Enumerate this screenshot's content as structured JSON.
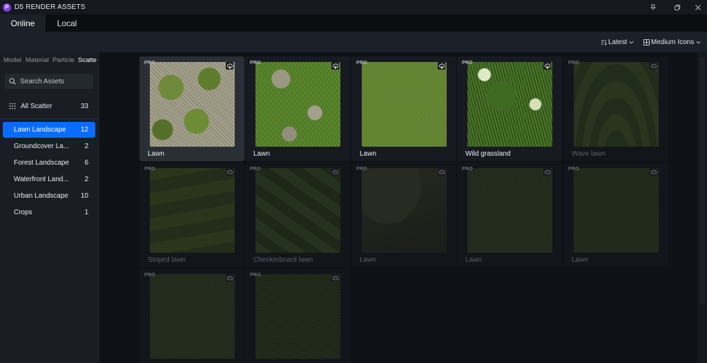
{
  "window": {
    "title": "D5 RENDER ASSETS",
    "logo_letter": "P"
  },
  "tabs": [
    {
      "label": "Online",
      "active": true
    },
    {
      "label": "Local",
      "active": false
    }
  ],
  "toolbar": {
    "sort_label": "Latest",
    "view_label": "Medium Icons"
  },
  "sidebar": {
    "categories": [
      "Model",
      "Material",
      "Particle",
      "Scatte"
    ],
    "active_category": "Scatte",
    "search_placeholder": "Search Assets",
    "all": {
      "label": "All Scatter",
      "count": "33"
    },
    "items": [
      {
        "label": "Lawn Landscape",
        "count": "12",
        "active": true
      },
      {
        "label": "Groundcover La...",
        "count": "2",
        "active": false
      },
      {
        "label": "Forest Landscape",
        "count": "6",
        "active": false
      },
      {
        "label": "Waterfront Land...",
        "count": "2",
        "active": false
      },
      {
        "label": "Urban Landscape",
        "count": "10",
        "active": false
      },
      {
        "label": "Crops",
        "count": "1",
        "active": false
      }
    ]
  },
  "assets": [
    {
      "name": "Lawn",
      "badge": "PRO",
      "style": "patchy",
      "dim": false,
      "highlight": true
    },
    {
      "name": "Lawn",
      "badge": "PRO",
      "style": "patchy-green",
      "dim": false,
      "highlight": false
    },
    {
      "name": "Lawn",
      "badge": "PRO",
      "style": "fine",
      "dim": false,
      "highlight": false
    },
    {
      "name": "Wild grassland",
      "badge": "PRO",
      "style": "wild",
      "dim": false,
      "highlight": false
    },
    {
      "name": "Wave lawn",
      "badge": "PRO",
      "style": "wave",
      "dim": true,
      "highlight": false
    },
    {
      "name": "Striped lawn",
      "badge": "PRO",
      "style": "striped",
      "dim": true,
      "highlight": false
    },
    {
      "name": "Checkerboard lawn",
      "badge": "PRO",
      "style": "checker",
      "dim": true,
      "highlight": false
    },
    {
      "name": "Lawn",
      "badge": "PRO",
      "style": "hill",
      "dim": true,
      "highlight": false
    },
    {
      "name": "Lawn",
      "badge": "PRO",
      "style": "dark",
      "dim": true,
      "highlight": false
    },
    {
      "name": "Lawn",
      "badge": "PRO",
      "style": "dark2",
      "dim": true,
      "highlight": false
    },
    {
      "name": "",
      "badge": "PRO",
      "style": "dark",
      "dim": true,
      "highlight": false
    },
    {
      "name": "",
      "badge": "PRO",
      "style": "dark3",
      "dim": true,
      "highlight": false
    }
  ],
  "colors": {
    "accent": "#0a6cff",
    "logo": "#7b3fe4",
    "background": "#0e1116",
    "sidebar": "#1a1d24",
    "toolbar": "#1c2028"
  }
}
